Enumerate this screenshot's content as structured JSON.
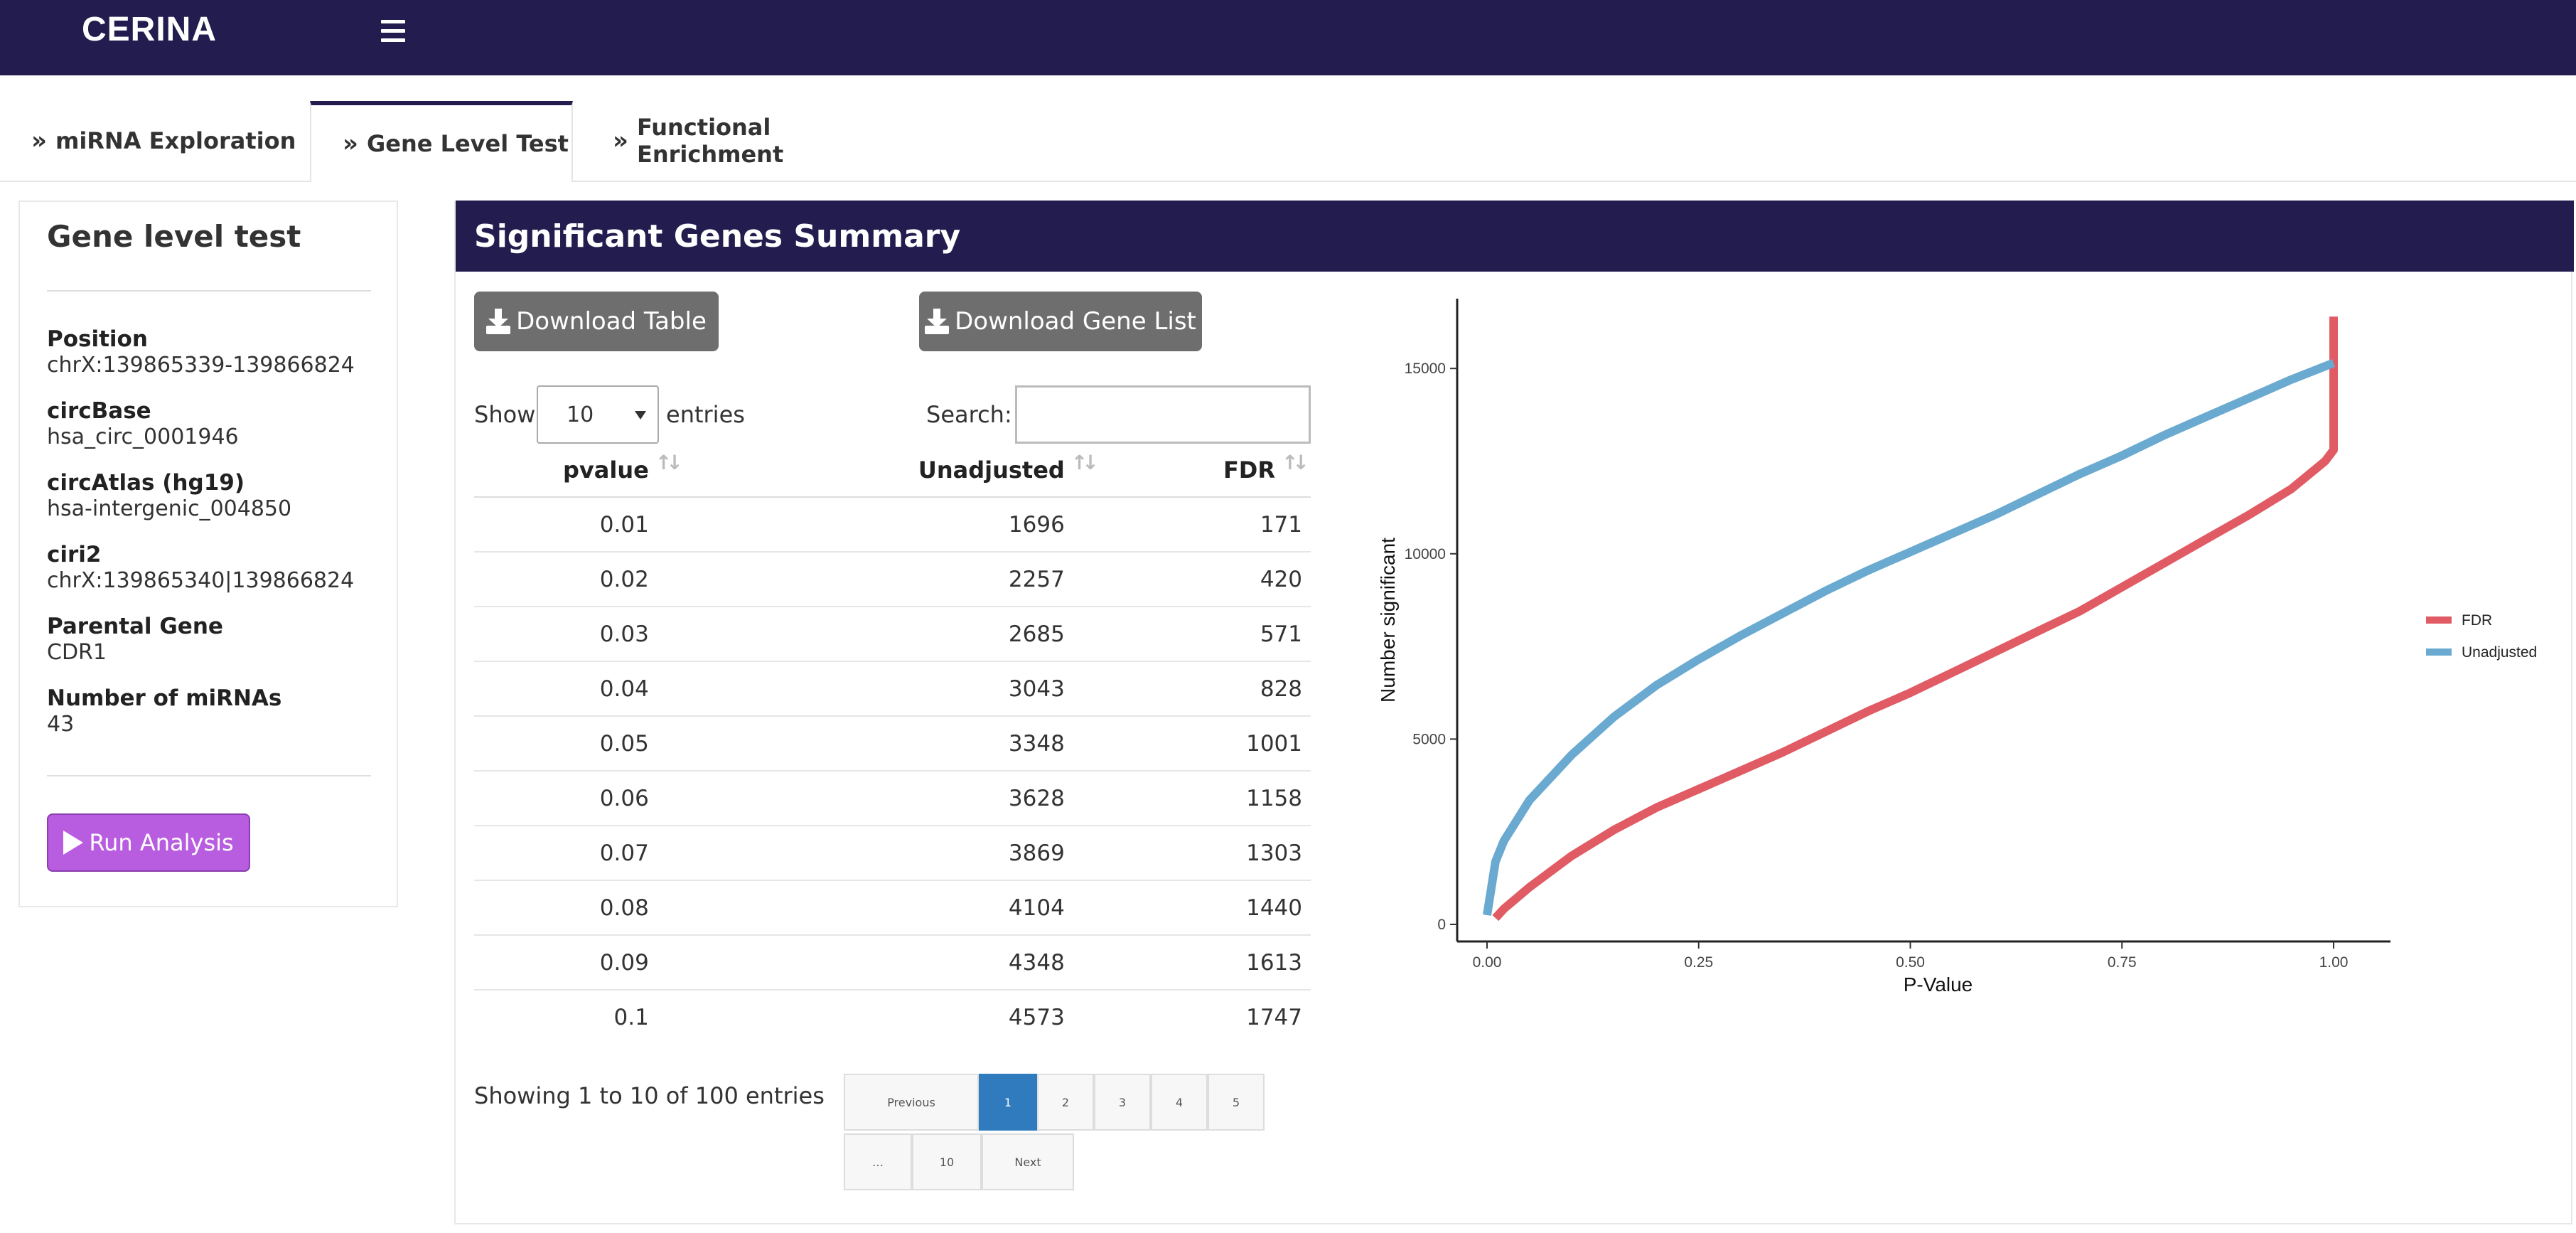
{
  "app": {
    "brand": "CERINA"
  },
  "tabs": [
    {
      "label": "miRNA Exploration",
      "active": false
    },
    {
      "label": "Gene Level Test",
      "active": true
    },
    {
      "label": "Functional Enrichment",
      "active": false
    }
  ],
  "sidebar": {
    "title": "Gene level test",
    "fields": [
      {
        "label": "Position",
        "value": "chrX:139865339-139866824"
      },
      {
        "label": "circBase",
        "value": "hsa_circ_0001946"
      },
      {
        "label": "circAtlas (hg19)",
        "value": "hsa-intergenic_004850"
      },
      {
        "label": "ciri2",
        "value": "chrX:139865340|139866824"
      },
      {
        "label": "Parental Gene",
        "value": "CDR1"
      },
      {
        "label": "Number of miRNAs",
        "value": "43"
      }
    ],
    "run_button": "Run Analysis"
  },
  "panel": {
    "title": "Significant Genes Summary",
    "download_table": "Download Table",
    "download_gene_list": "Download Gene List",
    "show_label": "Show",
    "entries_label": "entries",
    "page_length": "10",
    "search_label": "Search:",
    "search_value": "",
    "columns": [
      "pvalue",
      "Unadjusted",
      "FDR"
    ],
    "rows": [
      [
        "0.01",
        "1696",
        "171"
      ],
      [
        "0.02",
        "2257",
        "420"
      ],
      [
        "0.03",
        "2685",
        "571"
      ],
      [
        "0.04",
        "3043",
        "828"
      ],
      [
        "0.05",
        "3348",
        "1001"
      ],
      [
        "0.06",
        "3628",
        "1158"
      ],
      [
        "0.07",
        "3869",
        "1303"
      ],
      [
        "0.08",
        "4104",
        "1440"
      ],
      [
        "0.09",
        "4348",
        "1613"
      ],
      [
        "0.1",
        "4573",
        "1747"
      ]
    ],
    "info": "Showing 1 to 10 of 100 entries",
    "pagination": {
      "previous": "Previous",
      "pages": [
        "1",
        "2",
        "3",
        "4",
        "5"
      ],
      "ellipsis": "…",
      "last": "10",
      "next": "Next",
      "current": "1"
    }
  },
  "chart_data": {
    "type": "line",
    "xlabel": "P-Value",
    "ylabel": "Number significant",
    "xlim": [
      0,
      1
    ],
    "ylim": [
      0,
      16500
    ],
    "xticks": [
      "0.00",
      "0.25",
      "0.50",
      "0.75",
      "1.00"
    ],
    "yticks": [
      "0",
      "5000",
      "10000",
      "15000"
    ],
    "legend_position": "right",
    "series": [
      {
        "name": "FDR",
        "color": "#e05b63",
        "x": [
          0.01,
          0.02,
          0.05,
          0.1,
          0.15,
          0.2,
          0.25,
          0.3,
          0.35,
          0.4,
          0.45,
          0.5,
          0.55,
          0.6,
          0.65,
          0.7,
          0.75,
          0.8,
          0.85,
          0.9,
          0.95,
          0.99,
          1.0,
          1.0
        ],
        "y": [
          171,
          420,
          1001,
          1850,
          2550,
          3150,
          3650,
          4150,
          4650,
          5200,
          5750,
          6250,
          6800,
          7350,
          7900,
          8450,
          9100,
          9750,
          10400,
          11050,
          11750,
          12500,
          12800,
          16400
        ]
      },
      {
        "name": "Unadjusted",
        "color": "#6aa9d0",
        "x": [
          0.0,
          0.01,
          0.02,
          0.05,
          0.1,
          0.15,
          0.2,
          0.25,
          0.3,
          0.35,
          0.4,
          0.45,
          0.5,
          0.55,
          0.6,
          0.65,
          0.7,
          0.75,
          0.8,
          0.85,
          0.9,
          0.95,
          1.0
        ],
        "y": [
          250,
          1696,
          2257,
          3348,
          4573,
          5600,
          6450,
          7150,
          7800,
          8400,
          9000,
          9550,
          10050,
          10550,
          11050,
          11600,
          12150,
          12650,
          13200,
          13700,
          14200,
          14700,
          15150
        ]
      }
    ]
  }
}
